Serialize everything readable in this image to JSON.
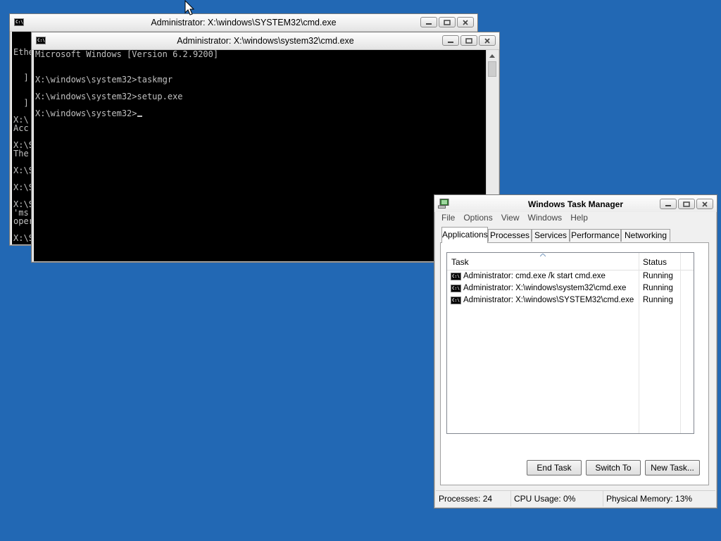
{
  "desktop": {
    "background_color": "#2268b4"
  },
  "back_cmd": {
    "title": "Administrator: X:\\windows\\SYSTEM32\\cmd.exe",
    "lines": [
      {
        "text": "Ethe"
      },
      {
        "text": "  "
      },
      {
        "text": "  ]"
      },
      {
        "text": "  "
      },
      {
        "text": "  ]"
      },
      {
        "text": "X:\\"
      },
      {
        "text": "Acc"
      },
      {
        "text": "X:\\S"
      },
      {
        "text": "The"
      },
      {
        "text": "X:\\S"
      },
      {
        "text": "X:\\S"
      },
      {
        "text": "X:\\S"
      },
      {
        "text": "'ms"
      },
      {
        "text": "oper"
      },
      {
        "text": "X:\\S"
      }
    ]
  },
  "front_cmd": {
    "title": "Administrator: X:\\windows\\system32\\cmd.exe",
    "lines": [
      {
        "text": "Microsoft Windows [Version 6.2.9200]"
      },
      {
        "text": ""
      },
      {
        "text": ""
      },
      {
        "text": "X:\\windows\\system32>taskmgr"
      },
      {
        "text": ""
      },
      {
        "text": "X:\\windows\\system32>setup.exe"
      },
      {
        "text": ""
      },
      {
        "text": "X:\\windows\\system32>"
      }
    ]
  },
  "taskmgr": {
    "title": "Windows Task Manager",
    "menu": [
      "File",
      "Options",
      "View",
      "Windows",
      "Help"
    ],
    "tabs": [
      {
        "label": "Applications",
        "active": true
      },
      {
        "label": "Processes",
        "active": false
      },
      {
        "label": "Services",
        "active": false
      },
      {
        "label": "Performance",
        "active": false
      },
      {
        "label": "Networking",
        "active": false
      }
    ],
    "columns": {
      "task": "Task",
      "status": "Status"
    },
    "rows": [
      {
        "task": "Administrator: cmd.exe /k start cmd.exe",
        "status": "Running"
      },
      {
        "task": "Administrator: X:\\windows\\system32\\cmd.exe",
        "status": "Running"
      },
      {
        "task": "Administrator: X:\\windows\\SYSTEM32\\cmd.exe",
        "status": "Running"
      }
    ],
    "buttons": {
      "end_task": "End Task",
      "switch_to": "Switch To",
      "new_task": "New Task..."
    },
    "status": {
      "processes": "Processes: 24",
      "cpu": "CPU Usage: 0%",
      "memory": "Physical Memory: 13%"
    }
  },
  "icons": {
    "cmd_icon_text": "C:\\",
    "minimize": "minimize-icon",
    "maximize": "maximize-icon",
    "close": "close-icon"
  }
}
